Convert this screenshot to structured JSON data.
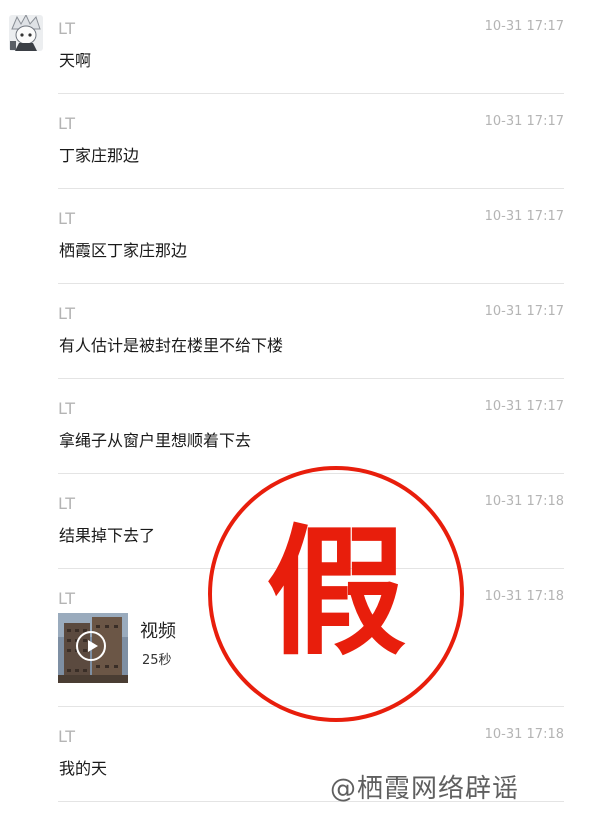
{
  "messages": [
    {
      "sender": "LT",
      "time": "10-31 17:17",
      "text": "天啊"
    },
    {
      "sender": "LT",
      "time": "10-31 17:17",
      "text": "丁家庄那边"
    },
    {
      "sender": "LT",
      "time": "10-31 17:17",
      "text": "栖霞区丁家庄那边"
    },
    {
      "sender": "LT",
      "time": "10-31 17:17",
      "text": "有人估计是被封在楼里不给下楼"
    },
    {
      "sender": "LT",
      "time": "10-31 17:17",
      "text": "拿绳子从窗户里想顺着下去"
    },
    {
      "sender": "LT",
      "time": "10-31 17:18",
      "text": "结果掉下去了"
    },
    {
      "sender": "LT",
      "time": "10-31 17:18",
      "video": {
        "title": "视频",
        "duration": "25秒"
      }
    },
    {
      "sender": "LT",
      "time": "10-31 17:18",
      "text": "我的天"
    }
  ],
  "stamp": {
    "text": "假",
    "color": "#e81e0c"
  },
  "watermark": "@栖霞网络辟谣",
  "colors": {
    "meta": "#b4b4b4",
    "divider": "#e4e4e4",
    "text": "#1a1a1a"
  },
  "icons": {
    "avatar": "anime-avatar-icon",
    "play": "play-icon"
  }
}
